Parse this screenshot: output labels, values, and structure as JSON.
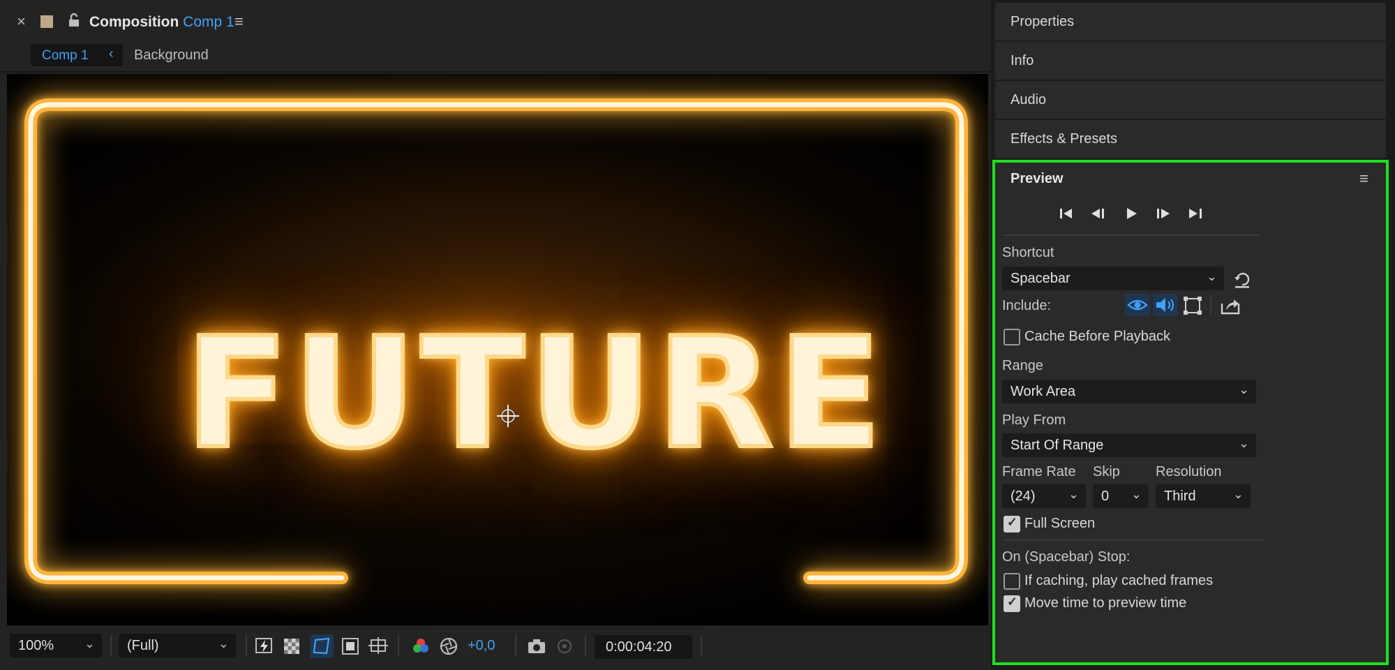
{
  "composition": {
    "close_glyph": "×",
    "title_prefix": "Composition",
    "title_name": "Comp 1",
    "menu_glyph": "≡",
    "breadcrumb": {
      "active": "Comp 1",
      "chevron": "‹",
      "next": "Background"
    },
    "viewer_text": "FUTURE",
    "toolbar": {
      "zoom": "100%",
      "resolution": "(Full)",
      "exposure": "+0,0",
      "timecode": "0:00:04:20",
      "chevron": "⌄"
    }
  },
  "right_panels": {
    "properties": "Properties",
    "info": "Info",
    "audio": "Audio",
    "effects_presets": "Effects & Presets"
  },
  "preview": {
    "title": "Preview",
    "menu_glyph": "≡",
    "shortcut_label": "Shortcut",
    "shortcut_value": "Spacebar",
    "include_label": "Include:",
    "cache_before_playback": {
      "label": "Cache Before Playback",
      "checked": false
    },
    "range_label": "Range",
    "range_value": "Work Area",
    "play_from_label": "Play From",
    "play_from_value": "Start Of Range",
    "frame_rate_label": "Frame Rate",
    "frame_rate_value": "(24)",
    "skip_label": "Skip",
    "skip_value": "0",
    "resolution_label": "Resolution",
    "resolution_value": "Third",
    "full_screen": {
      "label": "Full Screen",
      "checked": true
    },
    "on_stop_label": "On (Spacebar) Stop:",
    "if_caching": {
      "label": "If caching, play cached frames",
      "checked": false
    },
    "move_time": {
      "label": "Move time to preview time",
      "checked": true
    },
    "chevron": "⌄",
    "check_glyph": "✓"
  },
  "colors": {
    "accent_blue": "#3fa3f5",
    "highlight_green": "#1ee01e",
    "neon_orange": "#ffb43a"
  }
}
